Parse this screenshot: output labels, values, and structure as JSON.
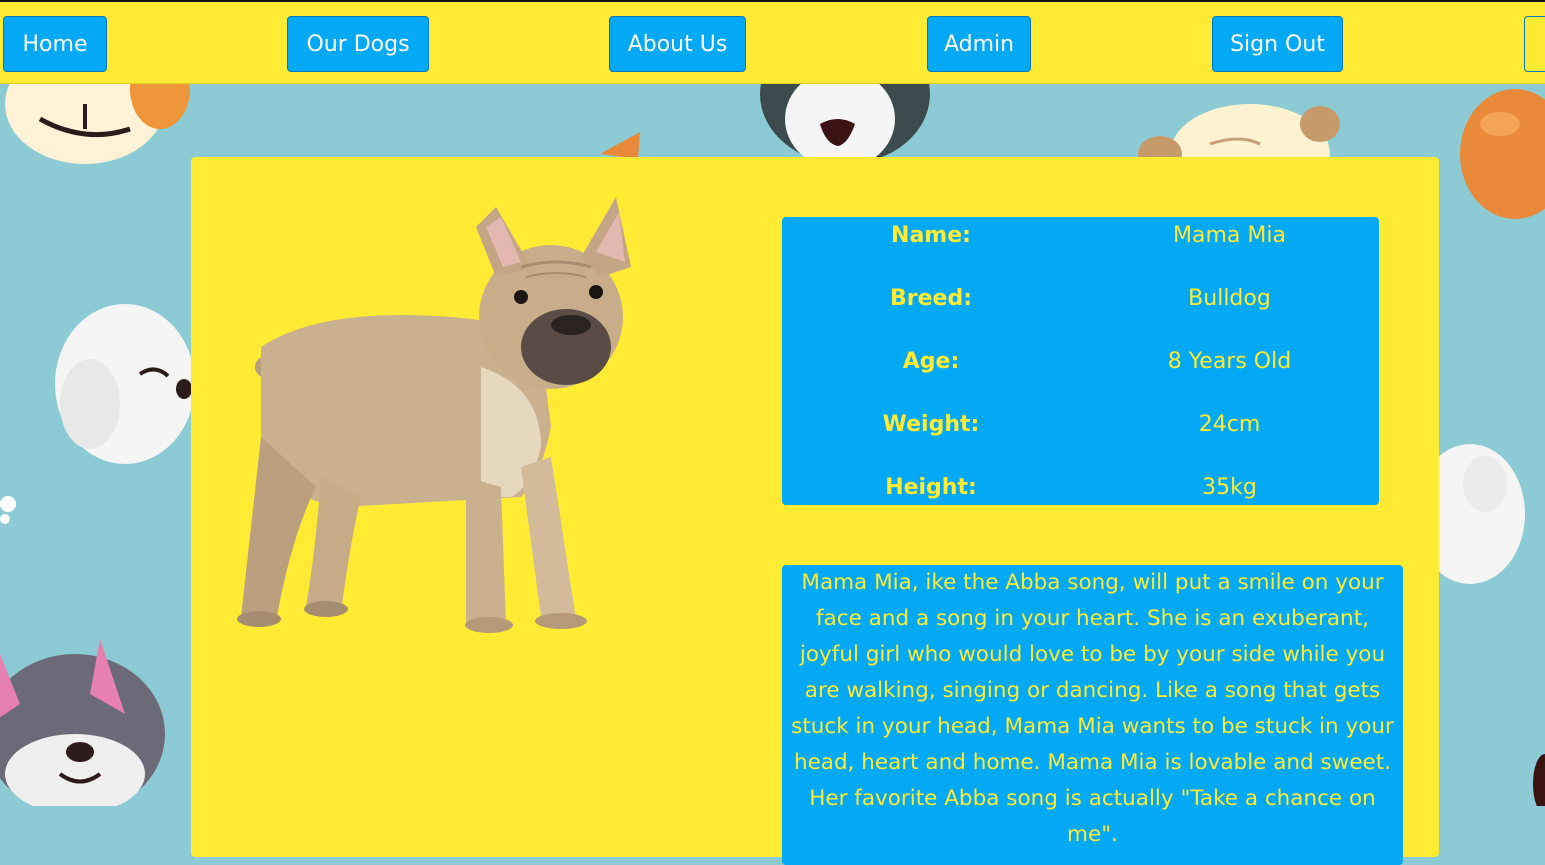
{
  "nav": {
    "items": [
      {
        "label": "Home"
      },
      {
        "label": "Our Dogs"
      },
      {
        "label": "About Us"
      },
      {
        "label": "Admin"
      },
      {
        "label": "Sign Out"
      }
    ]
  },
  "dog": {
    "details": [
      {
        "label": "Name:",
        "value": "Mama Mia"
      },
      {
        "label": "Breed:",
        "value": "Bulldog"
      },
      {
        "label": "Age:",
        "value": "8 Years Old"
      },
      {
        "label": "Weight:",
        "value": "24cm"
      },
      {
        "label": "Height:",
        "value": "35kg"
      }
    ],
    "description": "Mama Mia, ike the Abba song, will put a smile on your face and a song in your heart. She is an exuberant, joyful girl who would love to be by your side while you are walking, singing or dancing. Like a song that gets stuck in your head, Mama Mia wants to be stuck in your head, heart and home. Mama Mia is lovable and sweet. Her favorite Abba song is actually \"Take a chance on me\"."
  },
  "colors": {
    "nav_background": "#ffeb33",
    "button": "#03a9f4",
    "card": "#ffeb33",
    "panel": "#03a9f4",
    "panel_text": "#ffeb33",
    "page_background": "#8ccbd3"
  },
  "icons": {
    "background": "cartoon-dog-faces-pattern",
    "photo": "french-bulldog-photo"
  }
}
